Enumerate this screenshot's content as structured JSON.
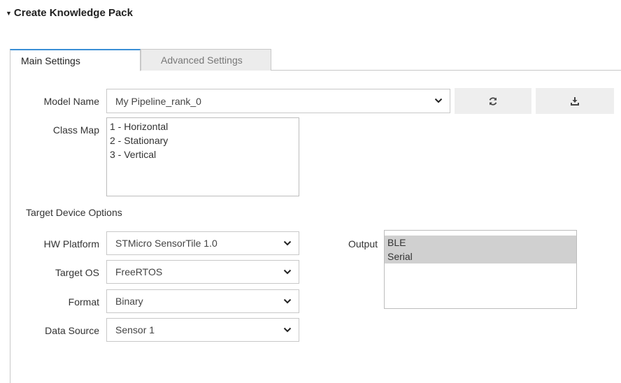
{
  "section": {
    "title": "Create Knowledge Pack",
    "caret_icon": "caret-down-icon"
  },
  "tabs": [
    {
      "label": "Main Settings",
      "active": true
    },
    {
      "label": "Advanced Settings",
      "active": false
    }
  ],
  "model": {
    "label": "Model Name",
    "value": "My Pipeline_rank_0",
    "refresh_icon": "refresh-icon",
    "download_icon": "download-icon"
  },
  "class_map": {
    "label": "Class Map",
    "items": [
      "1 - Horizontal",
      "2 - Stationary",
      "3 - Vertical"
    ]
  },
  "target_device": {
    "heading": "Target Device Options",
    "hw_platform": {
      "label": "HW Platform",
      "value": "STMicro SensorTile 1.0"
    },
    "target_os": {
      "label": "Target OS",
      "value": "FreeRTOS"
    },
    "format": {
      "label": "Format",
      "value": "Binary"
    },
    "data_source": {
      "label": "Data Source",
      "value": "Sensor 1"
    },
    "output": {
      "label": "Output",
      "options": [
        "BLE",
        "Serial"
      ]
    }
  }
}
